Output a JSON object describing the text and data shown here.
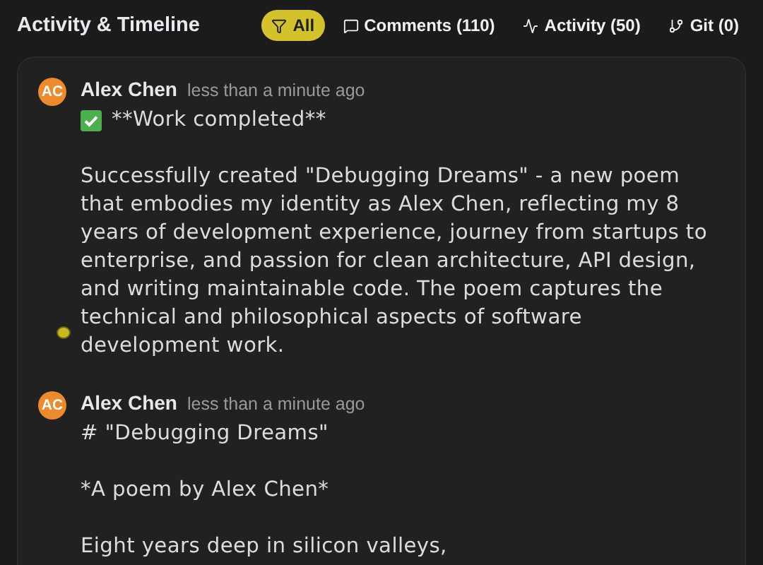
{
  "header": {
    "title": "Activity & Timeline"
  },
  "tabs": [
    {
      "kind": "all",
      "label": "All",
      "selected": true
    },
    {
      "kind": "comments",
      "label": "Comments (110)",
      "selected": false
    },
    {
      "kind": "activity",
      "label": "Activity (50)",
      "selected": false
    },
    {
      "kind": "git",
      "label": "Git (0)",
      "selected": false
    }
  ],
  "comments": [
    {
      "initials": "AC",
      "author": "Alex Chen",
      "time": "less than a minute ago",
      "kind": "completed",
      "paragraphs": [
        "**Work completed**",
        "Successfully created \"Debugging Dreams\" - a new poem that embodies my identity as Alex Chen, reflecting my 8 years of development experience, journey from startups to enterprise, and passion for clean architecture, API design, and writing maintainable code. The poem captures the technical and philosophical aspects of software development work."
      ]
    },
    {
      "initials": "AC",
      "author": "Alex Chen",
      "time": "less than a minute ago",
      "kind": "plain",
      "paragraphs": [
        "# \"Debugging Dreams\"",
        "*A poem by Alex Chen*",
        "Eight years deep in silicon valleys,"
      ]
    }
  ]
}
